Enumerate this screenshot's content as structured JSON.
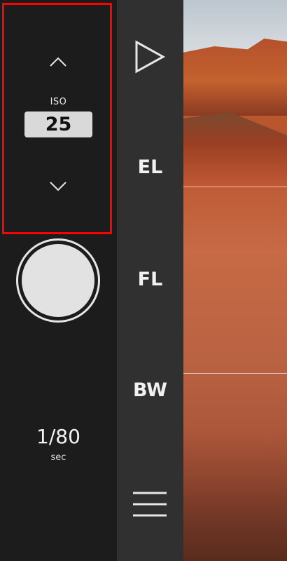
{
  "exposure": {
    "iso_label": "ISO",
    "iso_value": "25",
    "shutter_speed": "1/80",
    "shutter_unit": "sec"
  },
  "side_menu": {
    "el_label": "EL",
    "fl_label": "FL",
    "bw_label": "BW"
  },
  "icons": {
    "up": "chevron-up-icon",
    "down": "chevron-down-icon",
    "play": "play-icon",
    "menu": "hamburger-menu-icon"
  },
  "colors": {
    "highlight": "#ff0000",
    "panel_left": "#1c1c1c",
    "panel_mid": "#303030"
  }
}
